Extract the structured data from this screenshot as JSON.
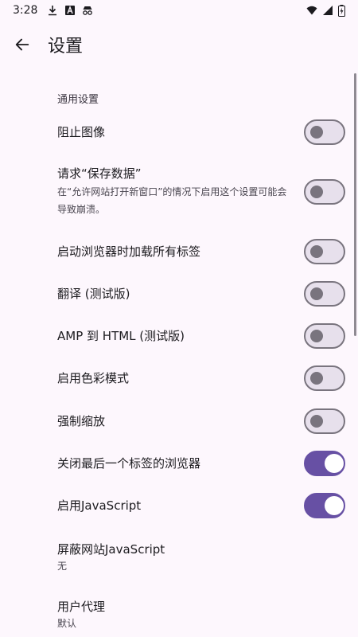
{
  "status_bar": {
    "time": "3:28",
    "left_icons": [
      "download-icon",
      "font-icon",
      "incognito-icon"
    ],
    "right_icons": [
      "wifi-icon",
      "signal-icon",
      "battery-icon"
    ]
  },
  "app_bar": {
    "title": "设置",
    "back_icon": "arrow-back-icon"
  },
  "section": {
    "header": "通用设置"
  },
  "settings": [
    {
      "title": "阻止图像",
      "summary": "",
      "toggle": "off"
    },
    {
      "title": "请求“保存数据”",
      "summary": "在“允许网站打开新窗口”的情况下启用这个设置可能会导致崩溃。",
      "toggle": "off"
    },
    {
      "title": "启动浏览器时加载所有标签",
      "summary": "",
      "toggle": "off"
    },
    {
      "title": "翻译 (测试版)",
      "summary": "",
      "toggle": "off"
    },
    {
      "title": "AMP 到 HTML (测试版)",
      "summary": "",
      "toggle": "off"
    },
    {
      "title": "启用色彩模式",
      "summary": "",
      "toggle": "off"
    },
    {
      "title": "强制缩放",
      "summary": "",
      "toggle": "off"
    },
    {
      "title": "关闭最后一个标签的浏览器",
      "summary": "",
      "toggle": "on"
    },
    {
      "title": "启用JavaScript",
      "summary": "",
      "toggle": "on"
    },
    {
      "title": "屏蔽网站JavaScript",
      "summary": "无",
      "toggle": ""
    },
    {
      "title": "用户代理",
      "summary": "默认",
      "toggle": ""
    }
  ],
  "colors": {
    "background": "#fdf7fd",
    "accent": "#6750a4",
    "switch_off_track": "#e7e0ec",
    "switch_off_outline": "#79747e"
  }
}
